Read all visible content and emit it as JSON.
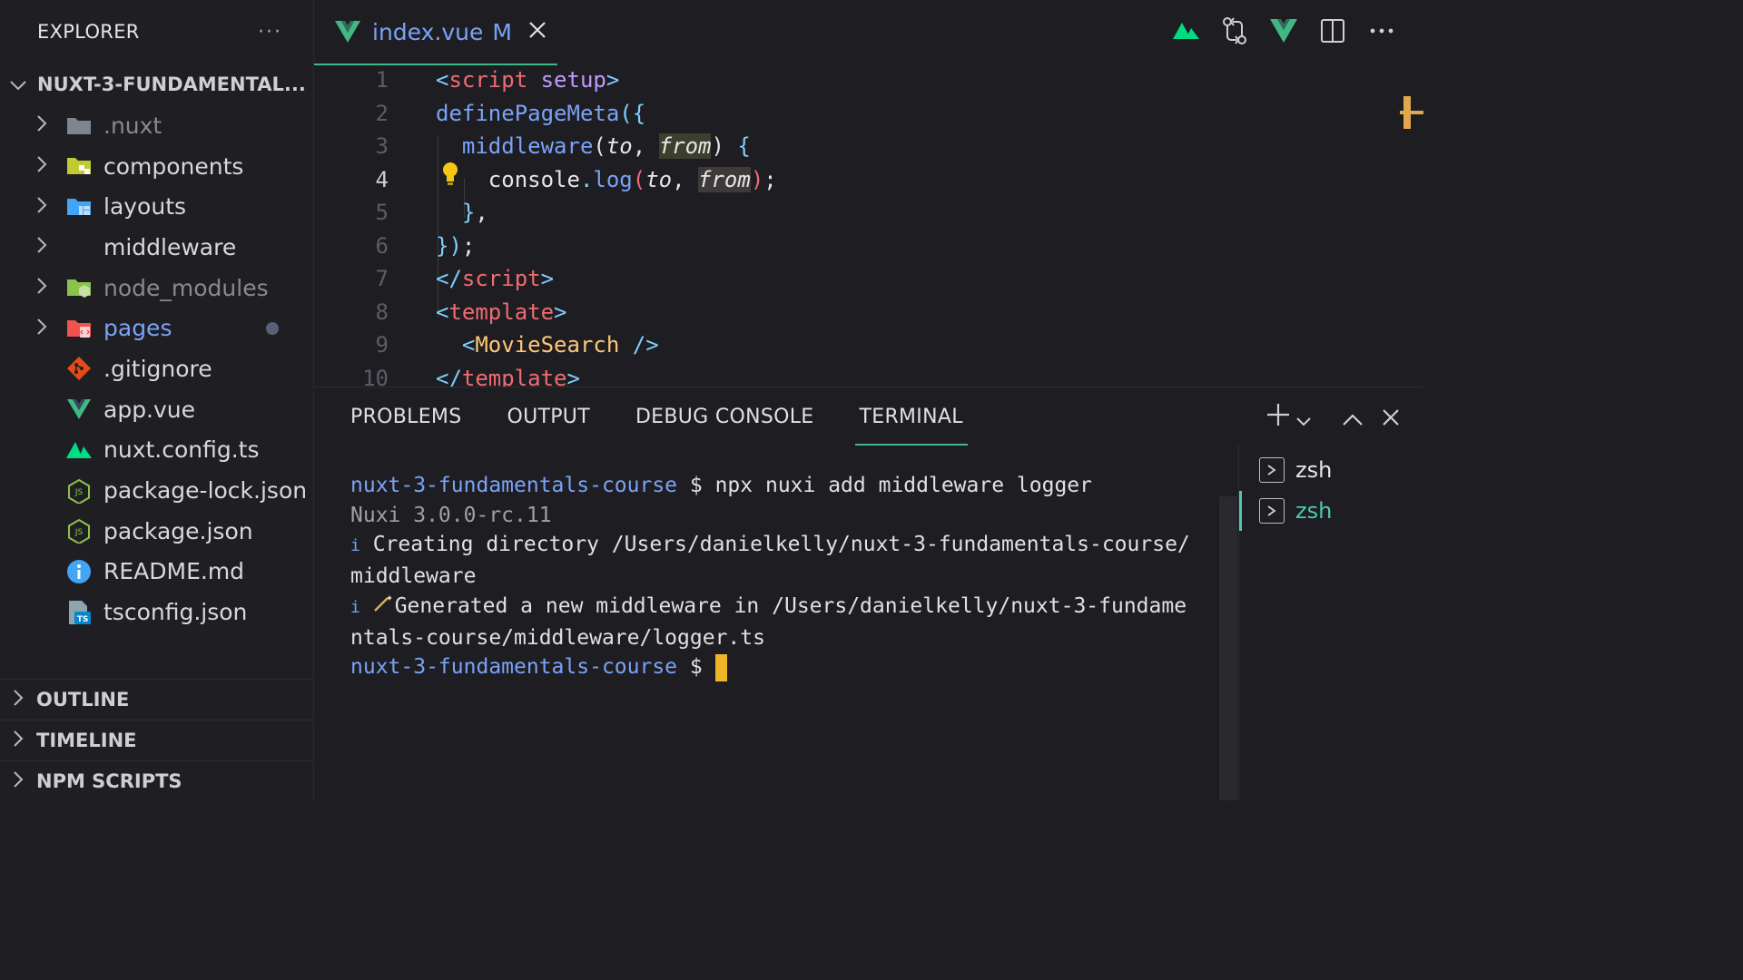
{
  "sidebar": {
    "title": "EXPLORER",
    "more": "···",
    "project": "NUXT-3-FUNDAMENTAL...",
    "items": [
      {
        "label": ".nuxt",
        "icon": "folder-icon"
      },
      {
        "label": "components",
        "icon": "folder-components-icon"
      },
      {
        "label": "layouts",
        "icon": "folder-layouts-icon"
      },
      {
        "label": "middleware",
        "icon": ""
      },
      {
        "label": "node_modules",
        "icon": "folder-node-icon"
      },
      {
        "label": "pages",
        "icon": "folder-pages-icon"
      },
      {
        "label": ".gitignore",
        "icon": "git-icon"
      },
      {
        "label": "app.vue",
        "icon": "vue-icon"
      },
      {
        "label": "nuxt.config.ts",
        "icon": "nuxt-icon"
      },
      {
        "label": "package-lock.json",
        "icon": "node-icon"
      },
      {
        "label": "package.json",
        "icon": "node-icon"
      },
      {
        "label": "README.md",
        "icon": "info-icon"
      },
      {
        "label": "tsconfig.json",
        "icon": "ts-config-icon"
      }
    ],
    "sections": [
      "OUTLINE",
      "TIMELINE",
      "NPM SCRIPTS"
    ]
  },
  "tab": {
    "name": "index.vue",
    "flag": "M"
  },
  "code": {
    "line_numbers": [
      "1",
      "2",
      "3",
      "4",
      "5",
      "6",
      "7",
      "8",
      "9",
      "10"
    ]
  },
  "panel": {
    "tabs": [
      "PROBLEMS",
      "OUTPUT",
      "DEBUG CONSOLE",
      "TERMINAL"
    ],
    "active_tab": "TERMINAL",
    "terminal": {
      "prompt": "nuxt-3-fundamentals-course",
      "command": "$ npx nuxi add middleware logger",
      "version": "Nuxi 3.0.0-rc.11",
      "line3a": "Creating directory /Users/danielkelly/nuxt-3-fundamentals-course/",
      "line3b": "middleware",
      "line4a": "Generated a new middleware in /Users/danielkelly/nuxt-3-fundame",
      "line4b": "ntals-course/middleware/logger.ts",
      "info_mark": "i",
      "dollar": "$"
    },
    "sessions": [
      "zsh",
      "zsh"
    ]
  },
  "colors": {
    "accent": "#3fb98a",
    "link": "#7aa2f7",
    "cursor": "#f0b429"
  }
}
